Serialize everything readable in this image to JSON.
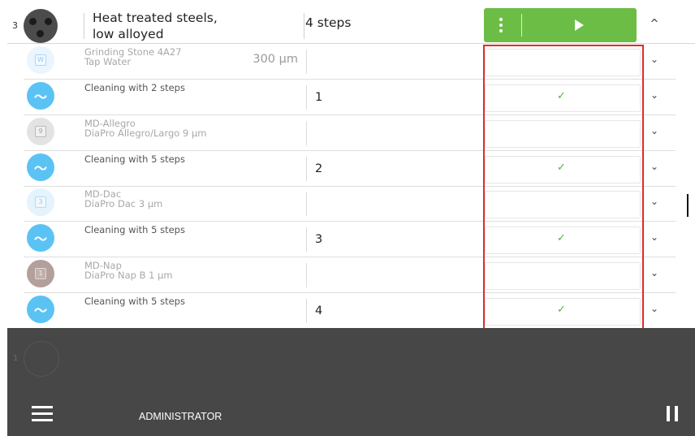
{
  "header": {
    "number": "3",
    "title_line1": "Heat treated steels,",
    "title_line2": "low alloyed",
    "steps": "4 steps",
    "colors": {
      "run_button": "#6cbd45",
      "highlight": "#e02b2b"
    }
  },
  "rows": [
    {
      "kind": "prep",
      "icon": "water-disc-icon",
      "badge": "W",
      "line1": "Grinding Stone 4A27",
      "line2": "Tap Water",
      "extra": "300 µm",
      "step": "",
      "checked": false
    },
    {
      "kind": "clean",
      "icon": "wave-icon",
      "badge": "",
      "line1": "Cleaning with 2 steps",
      "line2": "",
      "extra": "",
      "step": "1",
      "checked": true
    },
    {
      "kind": "prep",
      "icon": "disc-icon",
      "badge": "9",
      "line1": "MD-Allegro",
      "line2": "DiaPro Allegro/Largo 9 µm",
      "extra": "",
      "step": "",
      "checked": false
    },
    {
      "kind": "clean",
      "icon": "wave-icon",
      "badge": "",
      "line1": "Cleaning with 5 steps",
      "line2": "",
      "extra": "",
      "step": "2",
      "checked": true
    },
    {
      "kind": "prep",
      "icon": "disc-icon",
      "badge": "3",
      "line1": "MD-Dac",
      "line2": "DiaPro Dac 3 µm",
      "extra": "",
      "step": "",
      "checked": false
    },
    {
      "kind": "clean",
      "icon": "wave-icon",
      "badge": "",
      "line1": "Cleaning with 5 steps",
      "line2": "",
      "extra": "",
      "step": "3",
      "checked": true
    },
    {
      "kind": "prep",
      "icon": "disc-icon",
      "badge": "1",
      "line1": "MD-Nap",
      "line2": "DiaPro Nap B 1 µm",
      "extra": "",
      "step": "",
      "checked": false
    },
    {
      "kind": "clean",
      "icon": "wave-icon",
      "badge": "",
      "line1": "Cleaning with 5 steps",
      "line2": "",
      "extra": "",
      "step": "4",
      "checked": true
    }
  ],
  "footer": {
    "ghost_number": "1",
    "user": "ADMINISTRATOR"
  },
  "icons": {
    "check": "✓",
    "caret_down": "⌄",
    "caret_up": "^"
  }
}
